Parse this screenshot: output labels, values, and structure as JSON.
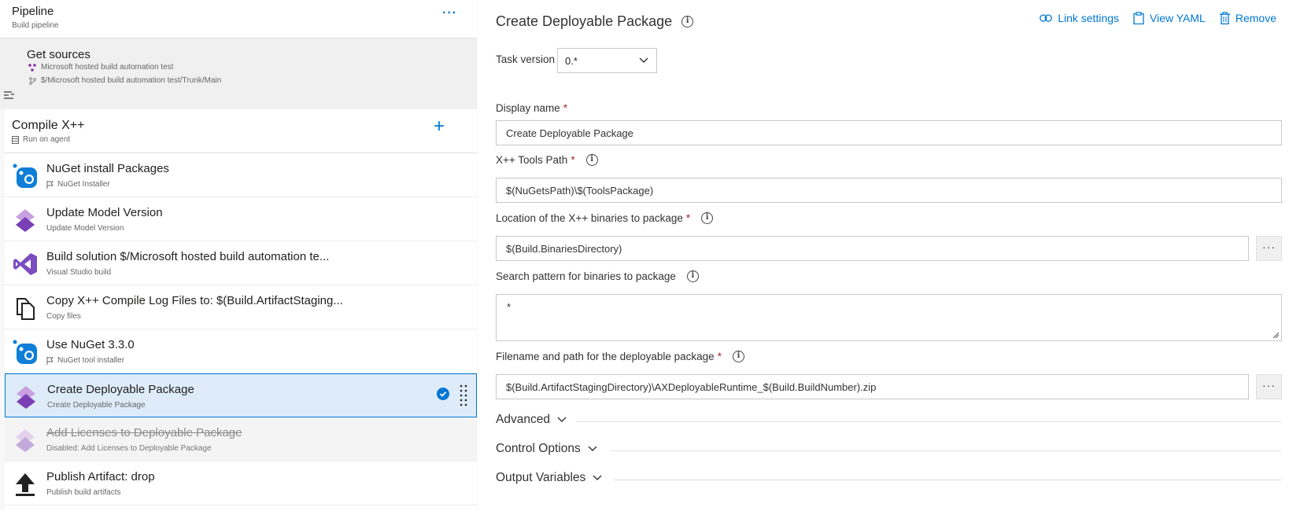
{
  "pipeline": {
    "title": "Pipeline",
    "subtitle": "Build pipeline",
    "more": "···"
  },
  "sources": {
    "title": "Get sources",
    "lines": [
      {
        "icon": "repo-icon",
        "text": "Microsoft hosted build automation test"
      },
      {
        "icon": "branch-icon",
        "text": "$/Microsoft hosted build automation test/Trunk/Main"
      }
    ]
  },
  "stage": {
    "title": "Compile X++",
    "subtitle": "Run on agent",
    "add": "+"
  },
  "tasks": [
    {
      "title": "NuGet install Packages",
      "subtitle": "NuGet Installer",
      "icon": "nuget-icon",
      "flag": true
    },
    {
      "title": "Update Model Version",
      "subtitle": "Update Model Version",
      "icon": "dynamics-icon",
      "flag": false
    },
    {
      "title": "Build solution $/Microsoft hosted build automation te...",
      "subtitle": "Visual Studio build",
      "icon": "visual-studio-icon",
      "flag": false
    },
    {
      "title": "Copy X++ Compile Log Files to: $(Build.ArtifactStaging...",
      "subtitle": "Copy files",
      "icon": "copy-files-icon",
      "flag": false
    },
    {
      "title": "Use NuGet 3.3.0",
      "subtitle": "NuGet tool installer",
      "icon": "nuget-icon",
      "flag": true
    },
    {
      "title": "Create Deployable Package",
      "subtitle": "Create Deployable Package",
      "icon": "dynamics-icon",
      "flag": false
    },
    {
      "title": "Add Licenses to Deployable Package",
      "subtitle": "Disabled: Add Licenses to Deployable Package",
      "icon": "dynamics-icon",
      "flag": false
    },
    {
      "title": "Publish Artifact: drop",
      "subtitle": "Publish build artifacts",
      "icon": "upload-icon",
      "flag": false
    }
  ],
  "detail": {
    "title": "Create Deployable Package",
    "actions": {
      "link": "Link settings",
      "yaml": "View YAML",
      "remove": "Remove"
    },
    "task_version": {
      "label": "Task version",
      "value": "0.*"
    },
    "display_name": {
      "label": "Display name",
      "value": "Create Deployable Package"
    },
    "tools_path": {
      "label": "X++ Tools Path",
      "value": "$(NuGetsPath)\\$(ToolsPackage)"
    },
    "binaries_location": {
      "label": "Location of the X++ binaries to package",
      "value": "$(Build.BinariesDirectory)"
    },
    "search_pattern": {
      "label": "Search pattern for binaries to package",
      "value": "*"
    },
    "package_path": {
      "label": "Filename and path for the deployable package",
      "value": "$(Build.ArtifactStagingDirectory)\\AXDeployableRuntime_$(Build.BuildNumber).zip"
    },
    "required_mark": "*",
    "ellipsis": "···",
    "sections": {
      "advanced": "Advanced",
      "control": "Control Options",
      "output": "Output Variables"
    }
  },
  "colors": {
    "accent": "#0078d4",
    "selected_bg": "#deecf9",
    "required": "#a4262c"
  }
}
